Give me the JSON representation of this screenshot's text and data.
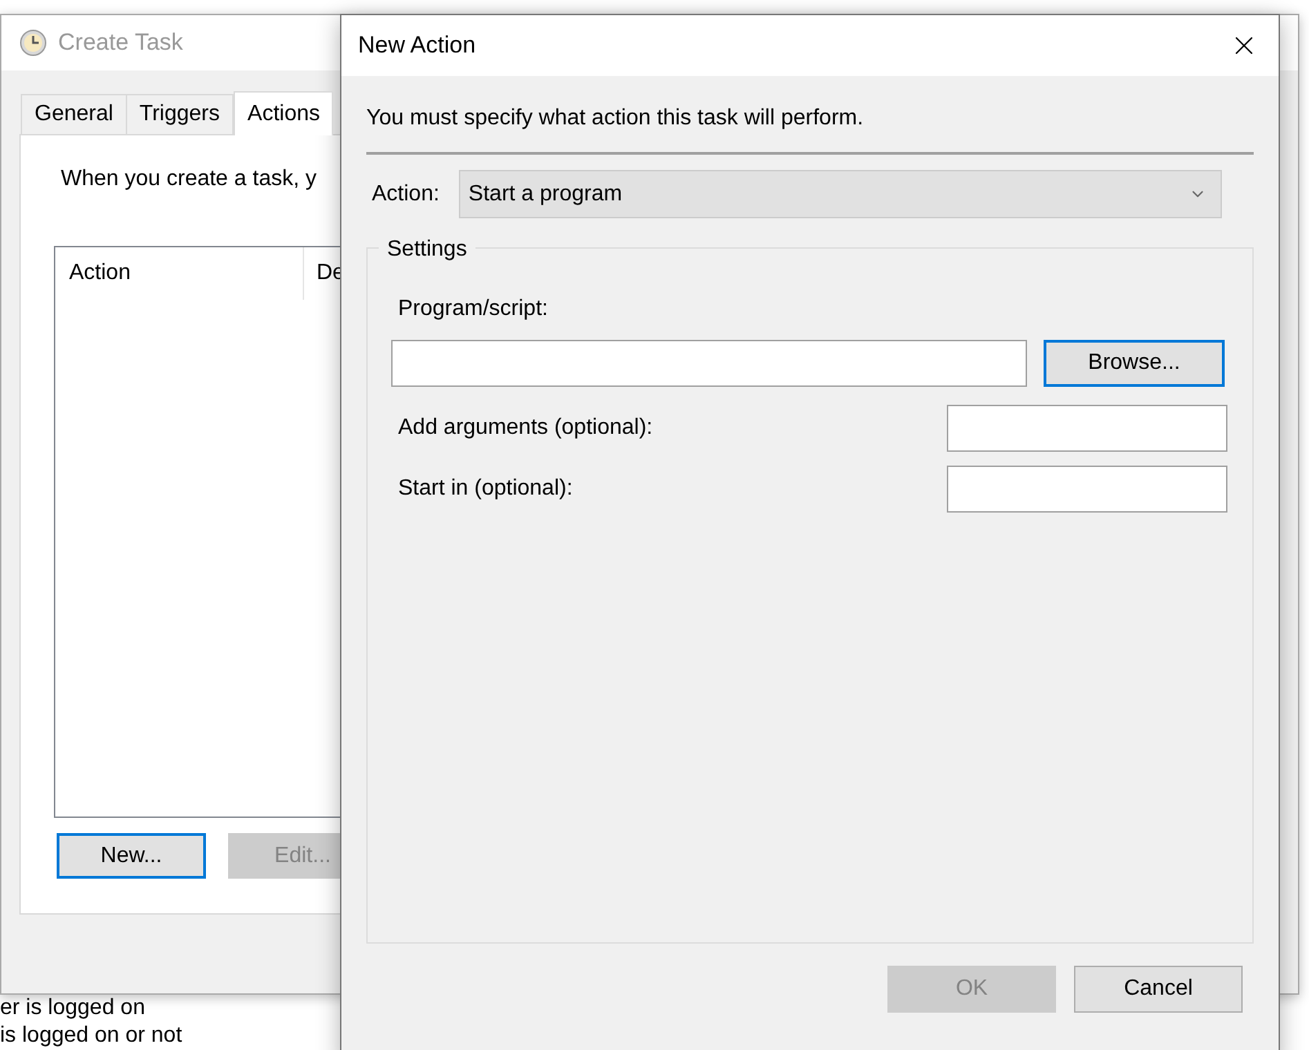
{
  "background_window": {
    "bottom_texts": [
      "er is logged on",
      "is logged on or not"
    ]
  },
  "create_task": {
    "title": "Create Task",
    "active": false,
    "tabs": [
      {
        "label": "General",
        "selected": false
      },
      {
        "label": "Triggers",
        "selected": false
      },
      {
        "label": "Actions",
        "selected": true
      }
    ],
    "description": "When you create a task, y",
    "table": {
      "columns": [
        "Action",
        "De"
      ]
    },
    "buttons": [
      {
        "label": "New...",
        "focused": true,
        "disabled": false
      },
      {
        "label": "Edit...",
        "focused": false,
        "disabled": true
      }
    ]
  },
  "new_action": {
    "title": "New Action",
    "instruction": "You must specify what action this task will perform.",
    "action": {
      "label": "Action:",
      "value": "Start a program"
    },
    "settings": {
      "legend": "Settings",
      "program_label": "Program/script:",
      "browse_button": "Browse...",
      "fields": [
        {
          "label": "Add arguments (optional):"
        },
        {
          "label": "Start in (optional):"
        }
      ]
    },
    "buttons": [
      {
        "label": "OK",
        "disabled": true
      },
      {
        "label": "Cancel",
        "disabled": false
      }
    ]
  }
}
